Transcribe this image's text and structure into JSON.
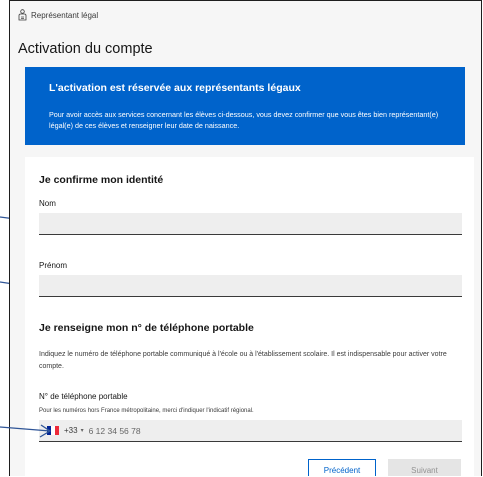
{
  "breadcrumb": {
    "icon": "user-role-icon",
    "label": "Représentant légal"
  },
  "page_title": "Activation du compte",
  "banner": {
    "title": "L'activation est réservée aux représentants légaux",
    "text": "Pour avoir accès aux services concernant les élèves ci-dessous, vous devez confirmer que vous êtes bien représentant(e) légal(e) de ces élèves et renseigner leur date de naissance."
  },
  "identity": {
    "heading": "Je confirme mon identité",
    "nom_label": "Nom",
    "nom_value": "",
    "prenom_label": "Prénom",
    "prenom_value": ""
  },
  "phone": {
    "heading": "Je renseigne mon n° de téléphone portable",
    "description": "Indiquez le numéro de téléphone portable communiqué à l'école ou à l'établissement scolaire. Il est indispensable pour activer votre compte.",
    "label": "N° de téléphone portable",
    "hint": "Pour les numéros hors France métropolitaine, merci d'indiquer l'indicatif régional.",
    "country_prefix": "+33",
    "placeholder": "6 12 34 56 78",
    "flag_colors": [
      "#002395",
      "#ffffff",
      "#ed2939"
    ]
  },
  "actions": {
    "previous": "Précédent",
    "next": "Suivant"
  },
  "colors": {
    "primary": "#0063cb",
    "arrow": "#2f5597"
  }
}
